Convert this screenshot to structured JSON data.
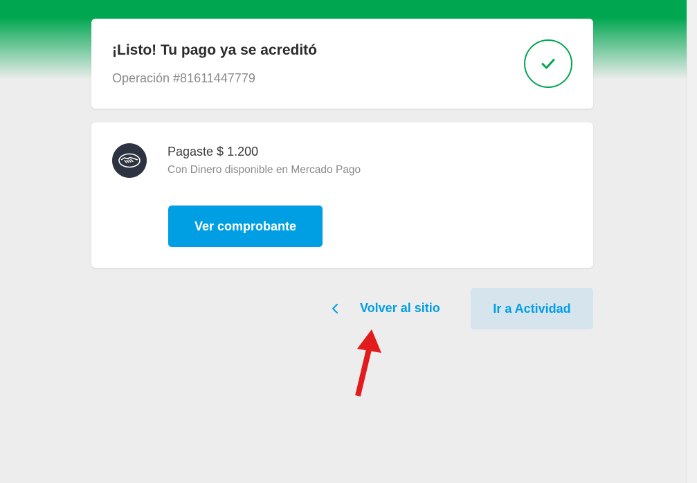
{
  "colors": {
    "brand_green": "#00a650",
    "brand_blue": "#009ee3",
    "annotation_red": "#e21c1c"
  },
  "status": {
    "title": "¡Listo! Tu pago ya se acreditó",
    "operation": "Operación #81611447779",
    "icon": "check-icon"
  },
  "payment": {
    "logo_icon": "handshake-icon",
    "amount": "Pagaste $ 1.200",
    "method": "Con Dinero disponible en Mercado Pago",
    "receipt_button": "Ver comprobante"
  },
  "actions": {
    "back_icon": "chevron-left-icon",
    "back_label": "Volver al sitio",
    "activity_button": "Ir a Actividad"
  },
  "annotation": {
    "icon": "red-arrow-icon"
  }
}
